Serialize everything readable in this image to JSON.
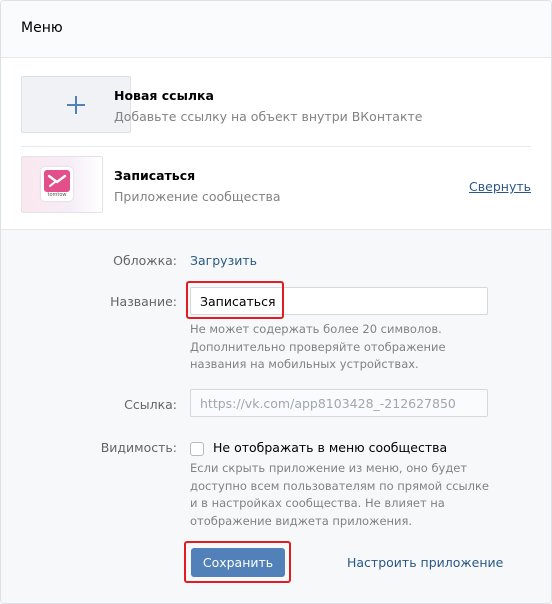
{
  "header": {
    "title": "Меню"
  },
  "items": [
    {
      "title": "Новая ссылка",
      "subtitle": "Добавьте ссылку на объект внутри ВКонтакте",
      "thumb_icon": "plus-icon"
    },
    {
      "title": "Записаться",
      "subtitle": "Приложение сообщества",
      "action": "Свернуть",
      "thumb_icon": "app-logo",
      "logo_text": "tomtow"
    }
  ],
  "form": {
    "cover_label": "Обложка:",
    "cover_action": "Загрузить",
    "name_label": "Название:",
    "name_value": "Записаться",
    "name_hint_lines": [
      "Не может содержать более 20 символов.",
      "Дополнительно проверяйте отображение",
      "названия на мобильных устройствах."
    ],
    "link_label": "Ссылка:",
    "link_value": "https://vk.com/app8103428_-212627850",
    "visibility_label": "Видимость:",
    "visibility_checkbox_label": "Не отображать в меню сообщества",
    "visibility_checked": false,
    "visibility_hint_lines": [
      "Если скрыть приложение из меню, оно будет",
      "доступно всем пользователям по прямой ссылке",
      "и в настройках сообщества. Не влияет на",
      "отображение виджета приложения."
    ],
    "save_label": "Сохранить",
    "configure_label": "Настроить приложение"
  },
  "colors": {
    "accent": "#5181b8",
    "link": "#2a5885",
    "highlight": "#e11d23",
    "app_brand": "#e34f8a"
  }
}
